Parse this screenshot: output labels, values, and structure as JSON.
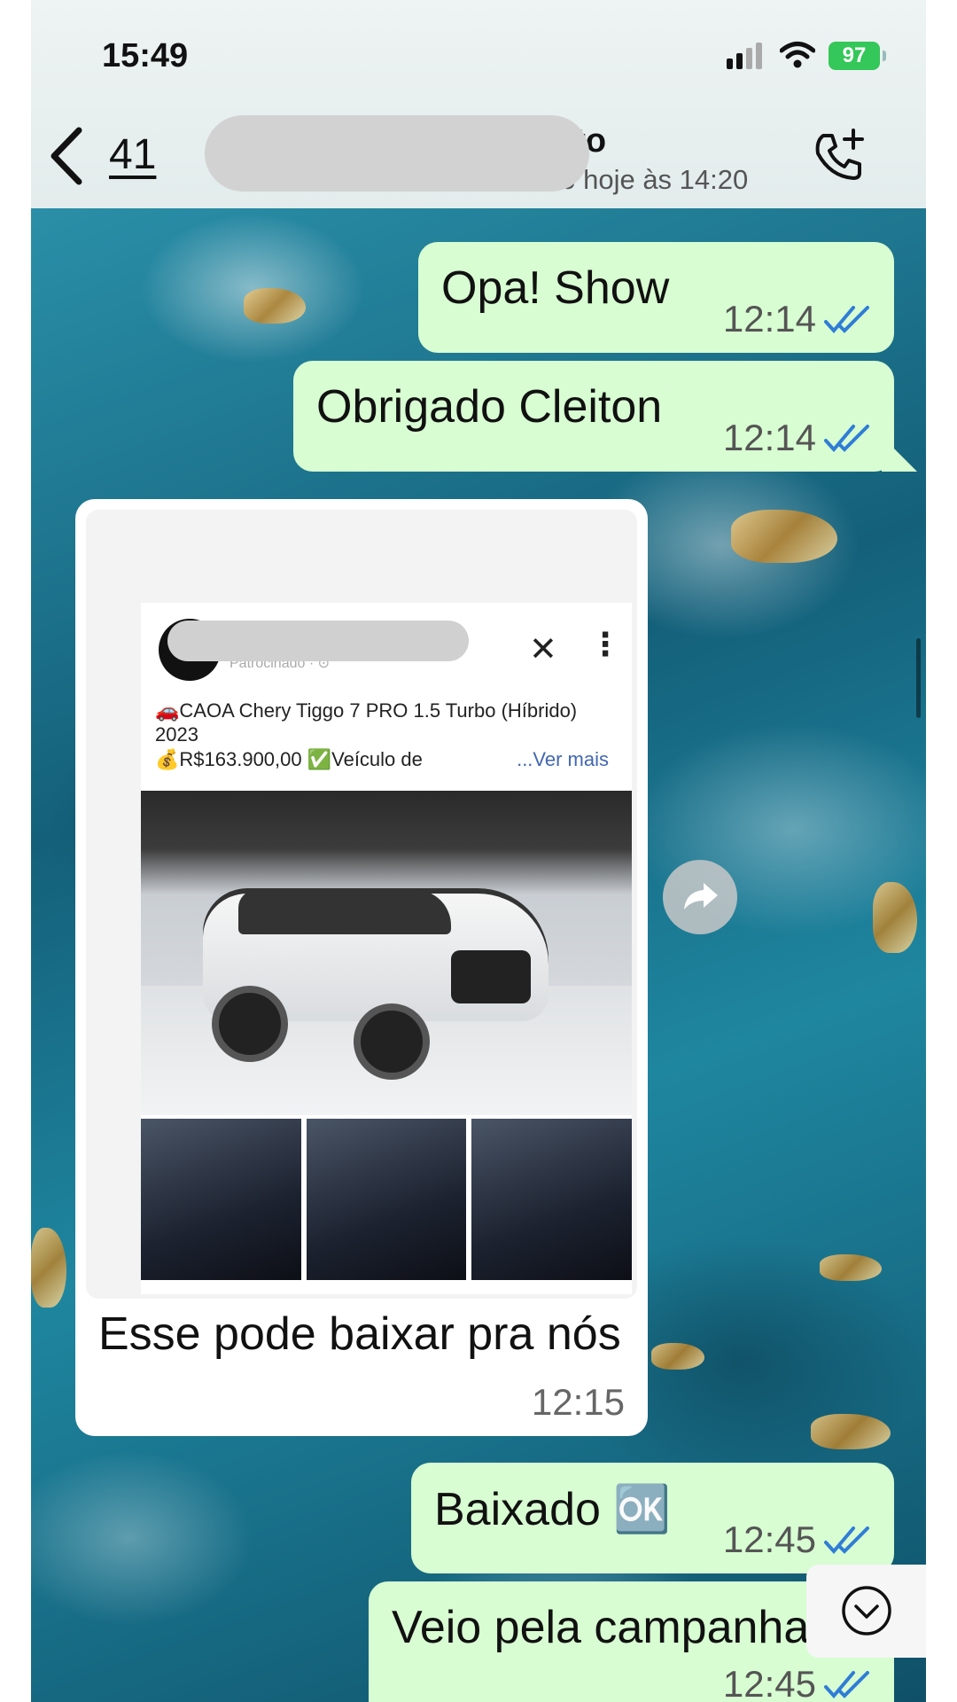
{
  "status_bar": {
    "time": "15:49",
    "battery": "97"
  },
  "header": {
    "unread_count": "41",
    "contact_name": "uto",
    "contact_status": "no hoje às 14:20"
  },
  "messages": [
    {
      "text": "Opa! Show",
      "time": "12:14",
      "direction": "out",
      "read": true
    },
    {
      "text": "Obrigado Cleiton",
      "time": "12:14",
      "direction": "out",
      "read": true
    },
    {
      "text": "Esse pode baixar pra nós",
      "time": "12:15",
      "direction": "in"
    },
    {
      "text": "Baixado 🆗",
      "time": "12:45",
      "direction": "out",
      "read": true
    },
    {
      "text": "Veio pela campanha",
      "time": "12:45",
      "direction": "out",
      "read": true
    }
  ],
  "ad": {
    "sponsor": "Patrocinado · ⊙",
    "title": "🚗CAOA Chery Tiggo 7 PRO 1.5 Turbo (Híbrido) 2023",
    "price": "💰R$163.900,00 ✅Veículo de",
    "more": "...Ver mais",
    "close": "✕",
    "menu": "⋮"
  },
  "colors": {
    "outgoing": "#d8fdd2",
    "incoming": "#ffffff",
    "read_ticks": "#2f7dd6",
    "battery": "#34c759"
  }
}
